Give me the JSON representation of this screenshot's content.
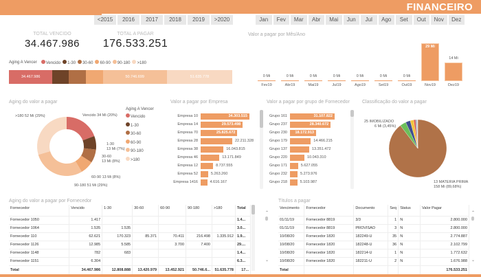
{
  "header": {
    "title": "FINANCEIRO",
    "accent": "#ee9c63"
  },
  "years": [
    "<2015",
    "2016",
    "2017",
    "2018",
    "2019",
    ">2020"
  ],
  "months": [
    "Jan",
    "Fev",
    "Mar",
    "Abr",
    "Mai",
    "Jun",
    "Jul",
    "Ago",
    "Set",
    "Out",
    "Nov",
    "Dez"
  ],
  "kpis": {
    "vencido_label": "TOTAL VENCIDO",
    "vencido_value": "34.467.986",
    "pagar_label": "TOTAL A PAGAR",
    "pagar_value": "176.533.251"
  },
  "aging_legend": {
    "title": "Aging A Vencer",
    "items": [
      {
        "label": "Vencido",
        "color": "#d86c66"
      },
      {
        "label": "1-30",
        "color": "#6e4328"
      },
      {
        "label": "30-60",
        "color": "#b06f45"
      },
      {
        "label": "60-90",
        "color": "#f0a872"
      },
      {
        "label": "90-180",
        "color": "#f5c098"
      },
      {
        "label": ">180",
        "color": "#f8d9c2"
      }
    ]
  },
  "aging_stack": {
    "values": [
      34467986,
      12808888,
      13420979,
      13452921,
      50746699,
      51635778
    ],
    "labels": [
      "34.467.986",
      "",
      "",
      "",
      "50.746.699",
      "51.635.778"
    ]
  },
  "chart_data": [
    {
      "type": "bar",
      "title": "Valor a pagar por Mês/Ano",
      "categories": [
        "Fev19",
        "Abr19",
        "Mai19",
        "Jul19",
        "Ago19",
        "Set19",
        "Out19",
        "Nov19",
        "Dez19"
      ],
      "values": [
        0,
        0,
        0,
        0,
        0,
        0,
        0,
        29,
        14
      ],
      "data_labels": [
        "0 Mi",
        "0 Mi",
        "0 Mi",
        "0 Mi",
        "0 Mi",
        "0 Mi",
        "0 Mi",
        "29 Mi",
        "14 Mi"
      ],
      "unit": "Mi"
    },
    {
      "type": "pie",
      "title": "Aging do valor a pagar",
      "donut": true,
      "categories": [
        "Vencido",
        "1-30",
        "30-60",
        "60-90",
        "90-180",
        ">180"
      ],
      "values": [
        34,
        13,
        13,
        13,
        51,
        52
      ],
      "data_labels": [
        "Vencido 34 Mi (20%)",
        "1-30\n13 Mi (7%)",
        "30-60\n13 Mi (8%)",
        "60-90 13 Mi (8%)",
        "90-180 51 Mi (29%)",
        ">180 52 Mi (29%)"
      ],
      "legend_title": "Aging A Vencer",
      "legend": "right"
    },
    {
      "type": "bar",
      "orientation": "horizontal",
      "title": "Valor a pagar por Empresa",
      "categories": [
        "Empresa 10",
        "Empresa 14",
        "Empresa 70",
        "Empresa 28",
        "Empresa 38",
        "Empresa 46",
        "Empresa 12",
        "Empresa 52",
        "Empresa 1416"
      ],
      "values": [
        34303515,
        29573498,
        25825672,
        22211328,
        16043815,
        13171849,
        8737555,
        5263260,
        4616167
      ],
      "data_labels": [
        "34.303.515",
        "29.573.498",
        "25.825.672",
        "22.211.328",
        "16.043.815",
        "13.171.849",
        "8.737.555",
        "5.263.260",
        "4.616.167"
      ]
    },
    {
      "type": "bar",
      "orientation": "horizontal",
      "title": "Valor a pagar por grupo de Fornecedor",
      "categories": [
        "Grupo 161",
        "Grupo 237",
        "Grupo 230",
        "Grupo 179",
        "Grupo 137",
        "Grupo 220",
        "Grupo 171",
        "Grupo 232",
        "Grupo 218"
      ],
      "values": [
        31107822,
        28340672,
        18172913,
        14466215,
        13351472,
        10043310,
        5627055,
        5273976,
        5103987
      ],
      "data_labels": [
        "31.107.822",
        "28.340.672",
        "18.172.913",
        "14.466.215",
        "13.351.472",
        "10.043.310",
        "5.627.055",
        "5.273.976",
        "5.103.987"
      ]
    },
    {
      "type": "pie",
      "title": "Classificação do valor a pagar",
      "categories": [
        "13 MATERIA PRIMA",
        "25 IMOBILIZADO",
        "",
        "",
        "",
        "",
        ""
      ],
      "values": [
        89.68,
        3.45,
        2.6,
        2.0,
        0.9,
        0.7,
        0.66
      ],
      "colors": [
        "#b07248",
        "#6cbf5a",
        "#3f4f8f",
        "#f2c53d",
        "#e04a3a",
        "#8a8fa0",
        "#d9d9d9"
      ],
      "data_labels": [
        "13 MATERIA PRIMA\n158 Mi (89,68%)",
        "25 IMOBILIZADO\n6 Mi (3,45%)"
      ]
    }
  ],
  "aging_table": {
    "title": "Aging do valor a pagar por Fornecedor",
    "columns": [
      "Fornecedor",
      "Vencido",
      "1-30",
      "30-60",
      "60-90",
      "90-180",
      ">180",
      "Total"
    ],
    "rows": [
      [
        "Fornecedor 1050",
        "1.417",
        "",
        "",
        "",
        "",
        "",
        "1.4..."
      ],
      [
        "Fornecedor 1064",
        "1.535",
        "1.535",
        "",
        "",
        "",
        "",
        "3.0..."
      ],
      [
        "Fornecedor 110",
        "62.621",
        "170.323",
        "85.371",
        "70.411",
        "216.498",
        "1.335.912",
        "1.9..."
      ],
      [
        "Fornecedor 1126",
        "12.985",
        "5.585",
        "",
        "3.700",
        "7.400",
        "",
        "29...."
      ],
      [
        "Fornecedor 1148",
        "782",
        "683",
        "",
        "",
        "",
        "",
        "1.4..."
      ],
      [
        "Fornecedor 1151",
        "6.304",
        "",
        "",
        "",
        "",
        "",
        "6.3..."
      ]
    ],
    "total": [
      "Total",
      "34.467.986",
      "12.808.888",
      "13.420.979",
      "13.452.921",
      "50.746.6...",
      "51.635.778",
      "17..."
    ]
  },
  "titulos_table": {
    "title": "Títulos a pagar",
    "columns": [
      "Vencimento",
      "Fornecedor",
      "Documento",
      "Seq",
      "Status",
      "Valor Pagar"
    ],
    "rows": [
      [
        "01/11/19",
        "Fornecedor 8819",
        "3/3",
        "1",
        "N",
        "2.800.000"
      ],
      [
        "01/11/19",
        "Fornecedor 8819",
        "PROVISAO",
        "3",
        "N",
        "2.800.000"
      ],
      [
        "10/08/20",
        "Fornecedor 1820",
        "182249-U",
        "35",
        "N",
        "2.774.887"
      ],
      [
        "10/08/20",
        "Fornecedor 1820",
        "182248-U",
        "36",
        "N",
        "2.102.799"
      ],
      [
        "10/08/20",
        "Fornecedor 1820",
        "182214-U",
        "1",
        "N",
        "1.772.632"
      ],
      [
        "10/08/20",
        "Fornecedor 1820",
        "182211-U",
        "2",
        "N",
        "1.676.988"
      ]
    ],
    "total": [
      "Total",
      "",
      "",
      "",
      "",
      "176.533.251"
    ]
  }
}
